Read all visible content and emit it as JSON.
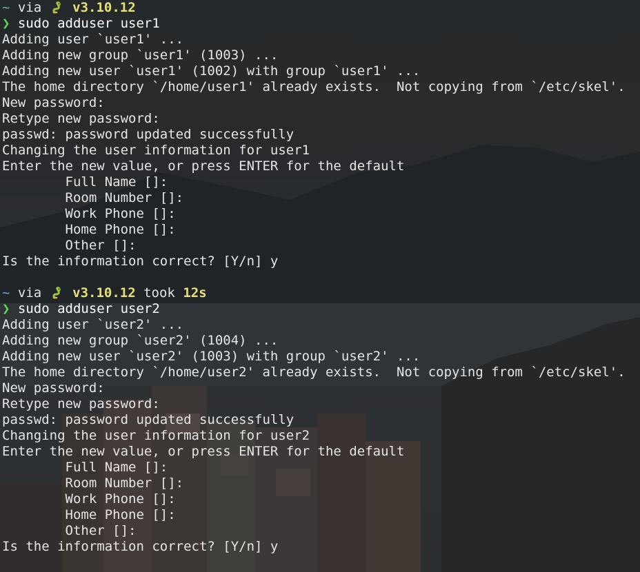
{
  "prompts": [
    {
      "tilde": "~",
      "via": "via",
      "python_icon": "python-snake-icon",
      "version": "v3.10.12",
      "took_label": "",
      "duration": "",
      "chevron": "❯",
      "command": "sudo adduser user1",
      "output": [
        "Adding user `user1' ...",
        "Adding new group `user1' (1003) ...",
        "Adding new user `user1' (1002) with group `user1' ...",
        "The home directory `/home/user1' already exists.  Not copying from `/etc/skel'.",
        "New password:",
        "Retype new password:",
        "passwd: password updated successfully",
        "Changing the user information for user1",
        "Enter the new value, or press ENTER for the default",
        "        Full Name []:",
        "        Room Number []:",
        "        Work Phone []:",
        "        Home Phone []:",
        "        Other []:",
        "Is the information correct? [Y/n] y"
      ]
    },
    {
      "tilde": "~",
      "via": "via",
      "python_icon": "python-snake-icon",
      "version": "v3.10.12",
      "took_label": "took",
      "duration": "12s",
      "chevron": "❯",
      "command": "sudo adduser user2",
      "output": [
        "Adding user `user2' ...",
        "Adding new group `user2' (1004) ...",
        "Adding new user `user2' (1003) with group `user2' ...",
        "The home directory `/home/user2' already exists.  Not copying from `/etc/skel'.",
        "New password:",
        "Retype new password:",
        "passwd: password updated successfully",
        "Changing the user information for user2",
        "Enter the new value, or press ENTER for the default",
        "        Full Name []:",
        "        Room Number []:",
        "        Work Phone []:",
        "        Home Phone []:",
        "        Other []:",
        "Is the information correct? [Y/n] y"
      ]
    }
  ],
  "colors": {
    "tilde": "#56b6c2",
    "version": "#e5e07a",
    "chevron": "#5fd75f",
    "text": "#e6e6e6"
  }
}
